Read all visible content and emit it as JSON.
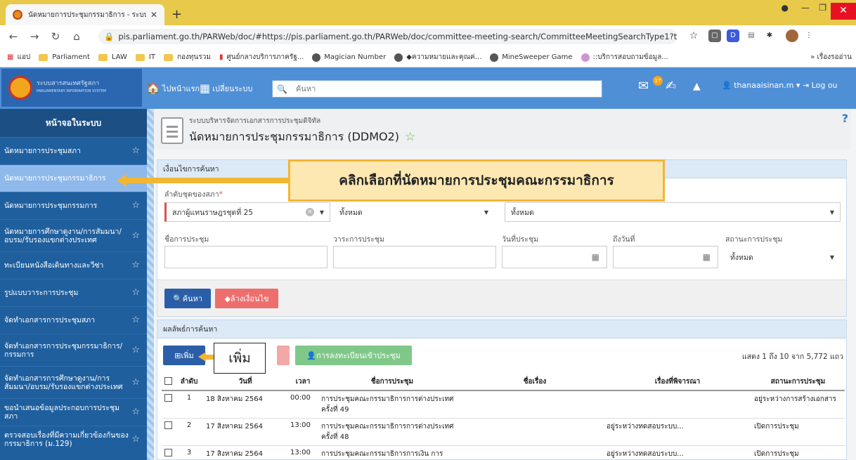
{
  "browser": {
    "tab_title": "นัดหมายการประชุมกรรมาธิการ - ระบบ",
    "url": "pis.parliament.go.th/PARWeb/doc/#https://pis.parliament.go.th/PARWeb/doc/committee-meeting-search/CommitteeMeetingSearchType1?type=1",
    "bookmarks": [
      "แอป",
      "Parliament",
      "LAW",
      "IT",
      "กองทุนรวม",
      "ศูนย์กลางบริการภาครัฐ...",
      "Magician Number",
      "◆ความหมายและคุณค่...",
      "MineSweeper Game",
      "::บริการสอบถามข้อมูล..."
    ],
    "bookmarks_right": "» เรื่องรออ่าน"
  },
  "header": {
    "logo_text": "ระบบสารสนเทศรัฐสภา",
    "logo_sub": "PARLIAMENTARY INFORMATION SYSTEM",
    "home_label": "ไปหน้าแรก",
    "switch_label": "เปลี่ยนระบบ",
    "search_placeholder": "ค้นหา",
    "mail_badge": "17",
    "username": "thanaaisinan.m ▾",
    "logout_label": "Log ou"
  },
  "sidebar": {
    "title": "หน้าจอในระบบ",
    "items": [
      {
        "label": "นัดหมายการประชุมสภา"
      },
      {
        "label": "นัดหมายการประชุมกรรมาธิการ"
      },
      {
        "label": "นัดหมายการประชุมกรรมการ"
      },
      {
        "label": "นัดหมายการศึกษาดูงาน/การสัมมนา/อบรม/รับรองแขกต่างประเทศ"
      },
      {
        "label": "ทะเบียนหนังสือเดินทางและวีซ่า"
      },
      {
        "label": "รูปแบบวาระการประชุม"
      },
      {
        "label": "จัดทำเอกสารการประชุมสภา"
      },
      {
        "label": "จัดทำเอกสารการประชุมกรรมาธิการ/กรรมการ"
      },
      {
        "label": "จัดทำเอกสารการศึกษาดูงาน/การสัมมนา/อบรม/รับรองแขกต่างประเทศ"
      },
      {
        "label": "ขอนำเสนอข้อมูลประกอบการประชุมสภา"
      },
      {
        "label": "ตรวจสอบเรื่องที่มีความเกี่ยวข้องกันของกรรมาธิการ (ม.129)"
      }
    ]
  },
  "page": {
    "breadcrumb": "ระบบบริหารจัดการเอกสารการประชุมดิจิทัล",
    "title": "นัดหมายการประชุมกรรมาธิการ (DDMO2)",
    "help": "?"
  },
  "filter": {
    "heading": "เงื่อนไขการค้นหา",
    "session_label": "ลำดับชุดของสภา",
    "session_value": "สภาผู้แทนราษฎรชุดที่ 25",
    "type1_value": "ทั้งหมด",
    "type2_value": "ทั้งหมด",
    "meeting_name_label": "ชื่อการประชุม",
    "agenda_label": "วาระการประชุม",
    "date_label": "วันที่ประชุม",
    "to_date_label": "ถึงวันที่",
    "status_label": "สถานะการประชุม",
    "status_value": "ทั้งหมด",
    "search_button": "ค้นหา",
    "clear_button": "ล้างเงื่อนไข"
  },
  "results": {
    "heading": "ผลลัพธ์การค้นหา",
    "add_button": "เพิ่ม",
    "register_button": "การลงทะเบียนเข้าประชุม",
    "summary": "แสดง 1 ถึง 10 จาก 5,772 แถว",
    "columns": [
      "ลำดับ",
      "วันที่",
      "เวลา",
      "ชื่อการประชุม",
      "ชื่อเรื่อง",
      "เรื่องที่พิจารณา",
      "สถานะการประชุม"
    ],
    "rows": [
      {
        "no": "1",
        "date": "18 สิงหาคม 2564",
        "time": "00:00",
        "name": "การประชุมคณะกรรมาธิการการต่างประเทศ ครั้งที่ 49",
        "subject": "",
        "topic": "",
        "status": "อยู่ระหว่างการสร้างเอกสาร"
      },
      {
        "no": "2",
        "date": "17 สิงหาคม 2564",
        "time": "13:00",
        "name": "การประชุมคณะกรรมาธิการการต่างประเทศ ครั้งที่ 48",
        "subject": "",
        "topic": "อยู่ระหว่างทดสอบระบบ...",
        "status": "เปิดการประชุม"
      },
      {
        "no": "3",
        "date": "17 สิงหาคม 2564",
        "time": "13:00",
        "name": "การประชุมคณะกรรมาธิการการเงิน การ",
        "subject": "",
        "topic": "อยู่ระหว่างทดสอบระบบ...",
        "status": "เปิดการประชุม"
      }
    ]
  },
  "annotations": {
    "main_callout": "คลิกเลือกที่นัดหมายการประชุมคณะกรรมาธิการ",
    "add_callout": "เพิ่ม"
  }
}
